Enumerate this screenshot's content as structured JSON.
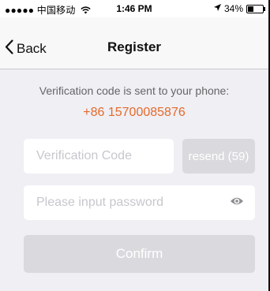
{
  "status_bar": {
    "carrier": "●●●●● 中国移动",
    "time": "1:46 PM",
    "battery_text": "34%"
  },
  "nav": {
    "back_label": "Back",
    "title": "Register"
  },
  "content": {
    "info_text": "Verification code is sent to your phone:",
    "phone_number": "+86 15700085876"
  },
  "form": {
    "code_placeholder": "Verification Code",
    "resend_label": "resend (59)",
    "password_placeholder": "Please input password",
    "confirm_label": "Confirm"
  },
  "colors": {
    "accent": "#e56a2b",
    "disabled_button": "#dadade",
    "background": "#efeff4"
  },
  "icons": {
    "signal": "wifi-icon",
    "location": "location-icon",
    "battery": "battery-icon",
    "back": "chevron-left-icon",
    "password_visibility": "eye-icon"
  }
}
